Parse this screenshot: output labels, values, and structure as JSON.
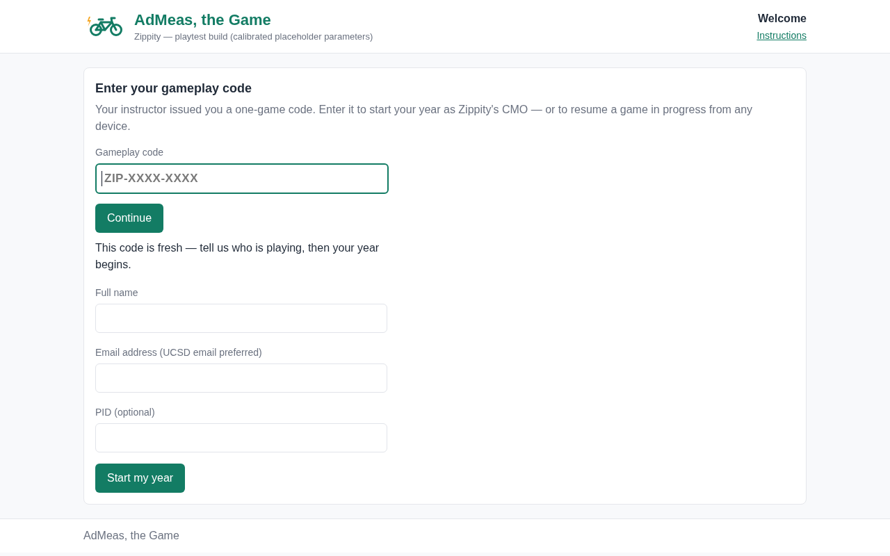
{
  "header": {
    "title": "AdMeas, the Game",
    "subtitle": "Zippity — playtest build (calibrated placeholder parameters)",
    "welcome": "Welcome",
    "link": "Instructions"
  },
  "card": {
    "title": "Enter your gameplay code",
    "description": "Your instructor issued you a one-game code. Enter it to start your year as Zippity's CMO — or to resume a game in progress from any device.",
    "code_field": {
      "label": "Gameplay code",
      "placeholder": "ZIP-XXXX-XXXX",
      "focused": true
    },
    "continue_button": "Continue",
    "notice": "This code is fresh — tell us who is playing, then your year begins.",
    "fields": [
      {
        "label": "Full name"
      },
      {
        "label": "Email address (UCSD email preferred)"
      },
      {
        "label": "PID (optional)"
      }
    ],
    "submit_button": "Start my year"
  },
  "footer": {
    "text": "AdMeas, the Game"
  }
}
